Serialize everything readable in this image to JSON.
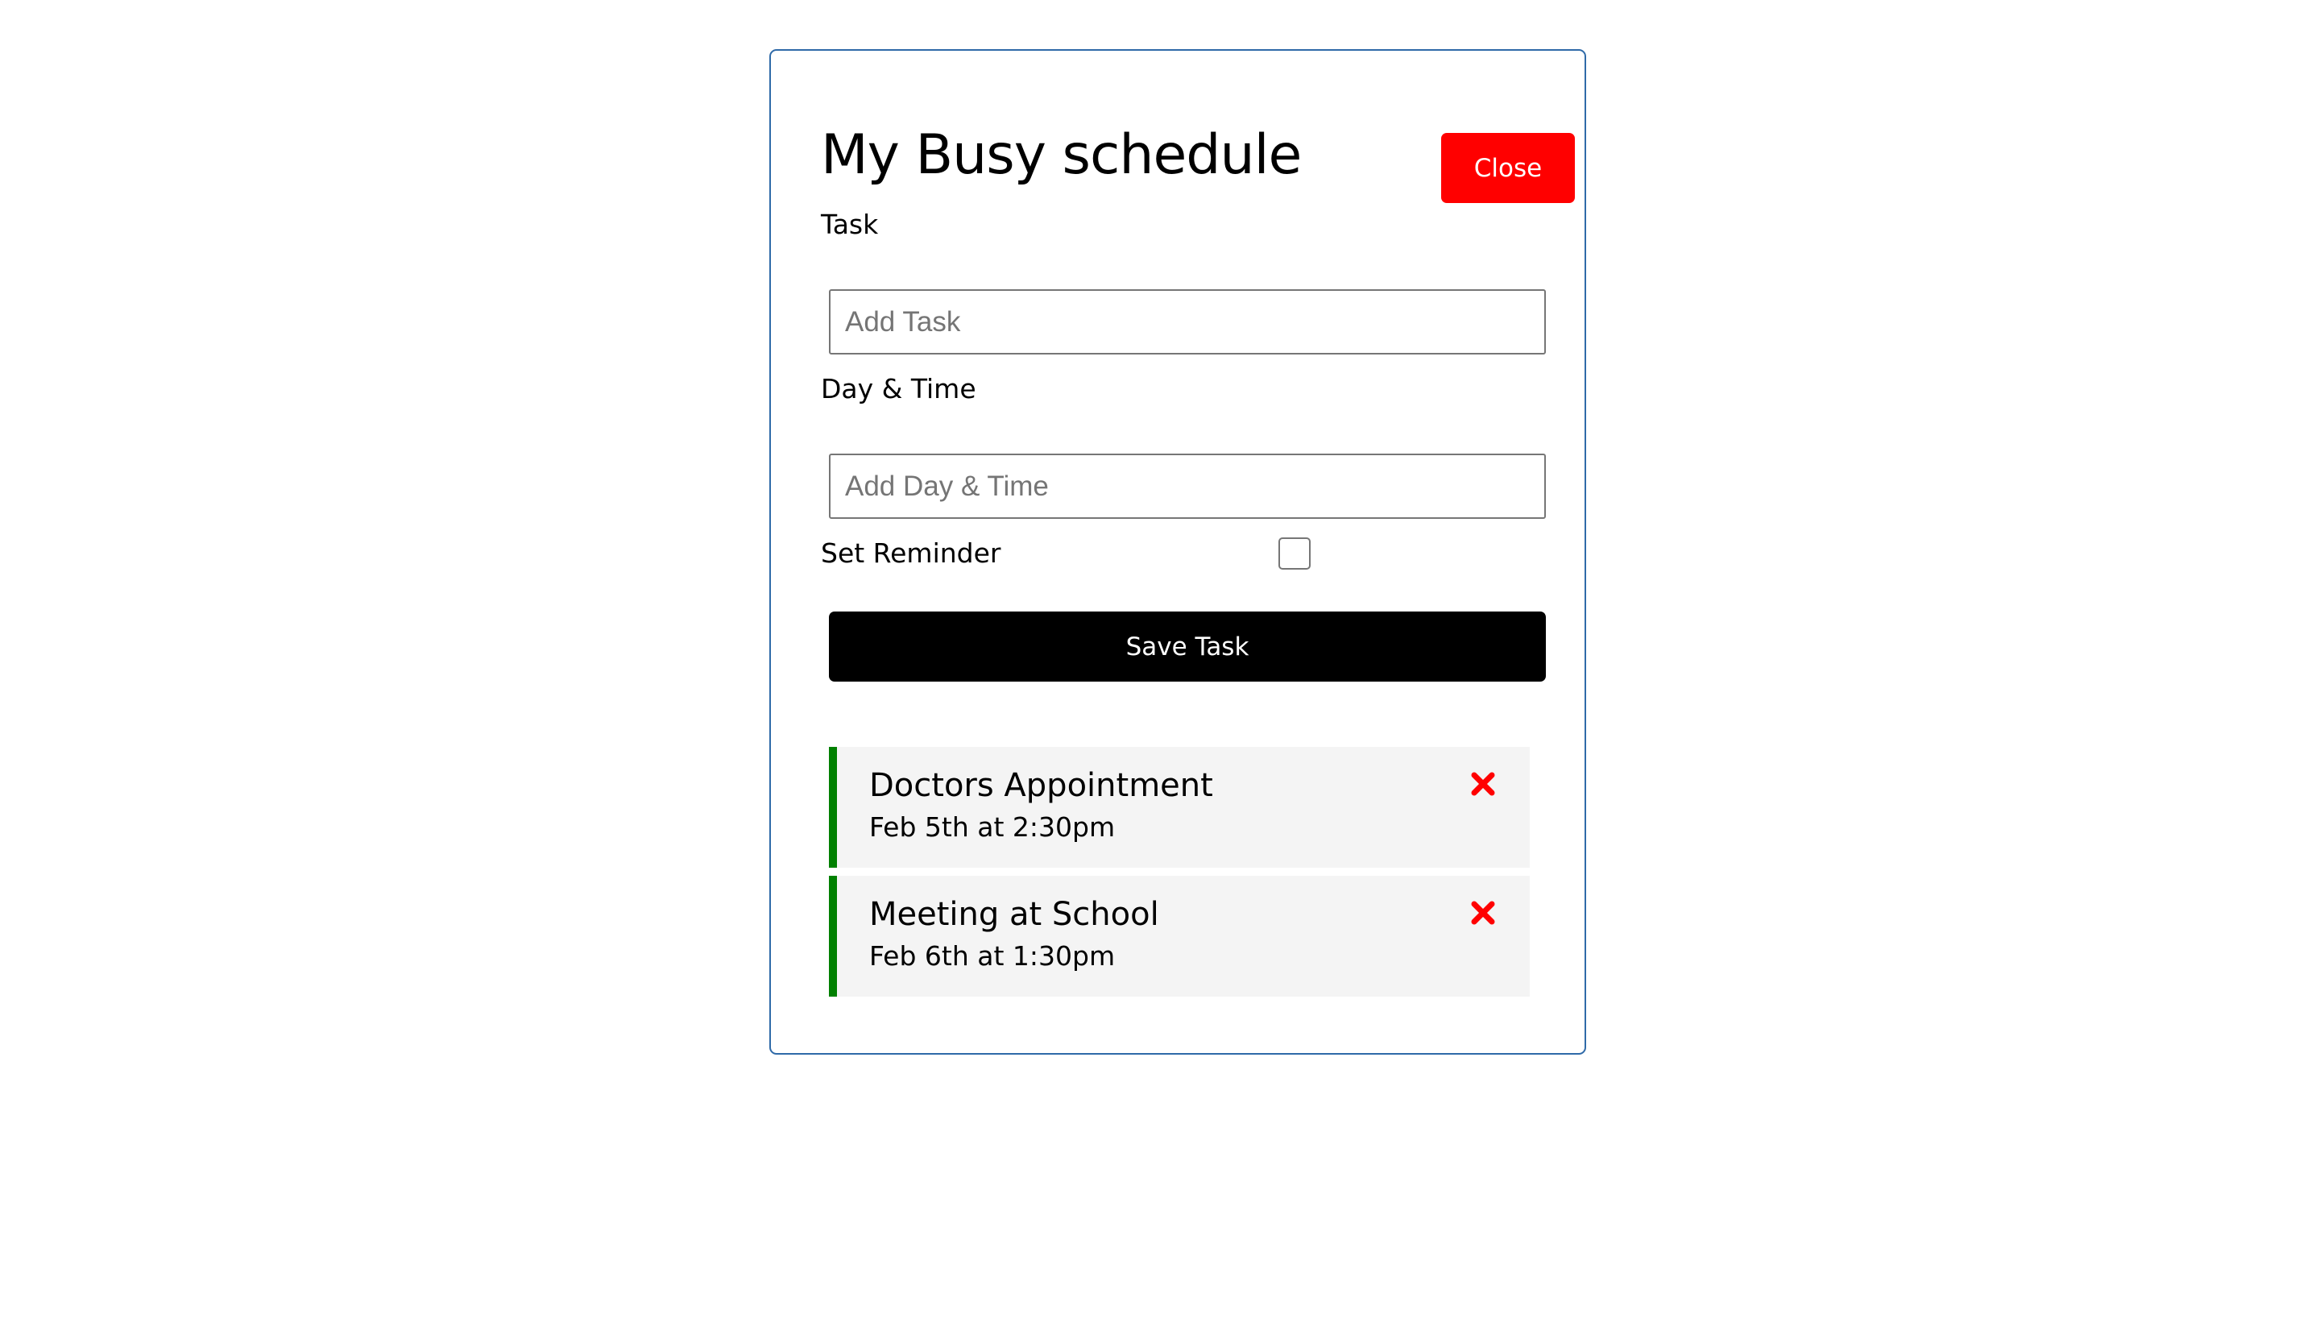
{
  "header": {
    "title": "My Busy schedule",
    "close_label": "Close"
  },
  "form": {
    "task_label": "Task",
    "task_placeholder": "Add Task",
    "task_value": "",
    "day_label": "Day & Time",
    "day_placeholder": "Add Day & Time",
    "day_value": "",
    "reminder_label": "Set Reminder",
    "reminder_checked": false,
    "save_label": "Save Task"
  },
  "tasks": [
    {
      "text": "Doctors Appointment",
      "day": "Feb 5th at 2:30pm",
      "reminder": true,
      "delete_icon": "times-icon"
    },
    {
      "text": "Meeting at School",
      "day": "Feb 6th at 1:30pm",
      "reminder": true,
      "delete_icon": "times-icon"
    }
  ],
  "colors": {
    "close_button": "#ff0000",
    "save_button": "#000000",
    "reminder_border": "#008000",
    "delete_icon": "#ff0000",
    "container_border": "#2f6aa8",
    "task_background": "#f4f4f4"
  }
}
